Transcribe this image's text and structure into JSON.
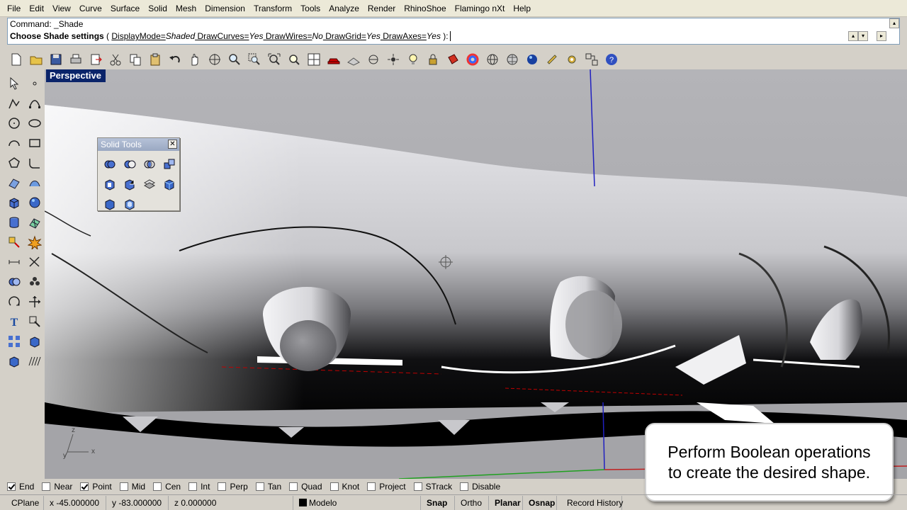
{
  "menu": [
    "File",
    "Edit",
    "View",
    "Curve",
    "Surface",
    "Solid",
    "Mesh",
    "Dimension",
    "Transform",
    "Tools",
    "Analyze",
    "Render",
    "RhinoShoe",
    "Flamingo nXt",
    "Help"
  ],
  "command": {
    "history_line": "Command: _Shade",
    "prompt_bold": "Choose Shade settings",
    "prompt_open": " ( ",
    "opt1_name": "DisplayMode=",
    "opt1_value": "Shaded",
    "opt2": " DrawCurves=",
    "opt2_value": "Yes",
    "opt3": " DrawWires=",
    "opt3_value": "No",
    "opt4": " DrawGrid=",
    "opt4_value": "Yes",
    "opt5": " DrawAxes=",
    "opt5_value": "Yes",
    "prompt_close": " ):"
  },
  "toolbar_icons": [
    "new-file-icon",
    "open-folder-icon",
    "save-icon",
    "print-icon",
    "export-icon",
    "cut-icon",
    "copy-icon",
    "paste-icon",
    "undo-icon",
    "pan-hand-icon",
    "rotate-view-icon",
    "zoom-icon",
    "zoom-window-icon",
    "zoom-extents-icon",
    "zoom-selected-icon",
    "four-viewports-icon",
    "car-icon",
    "grid-plane-icon",
    "cplane-icon",
    "point-icon",
    "light-bulb-icon",
    "lock-icon",
    "render-bucket-icon",
    "color-wheel-icon",
    "wire-sphere-icon",
    "mesh-sphere-icon",
    "shaded-sphere-icon",
    "render-light-icon",
    "gear-icon",
    "layout-icon",
    "help-icon"
  ],
  "viewport": {
    "title": "Perspective"
  },
  "axes": {
    "x": "x",
    "y": "y",
    "z": "z"
  },
  "solid_tools": {
    "title": "Solid Tools",
    "close": "✕"
  },
  "callout": {
    "line1": "Perform Boolean operations",
    "line2": "to create the desired shape."
  },
  "osnaps": [
    {
      "label": "End",
      "checked": true
    },
    {
      "label": "Near",
      "checked": false
    },
    {
      "label": "Point",
      "checked": true
    },
    {
      "label": "Mid",
      "checked": false
    },
    {
      "label": "Cen",
      "checked": false
    },
    {
      "label": "Int",
      "checked": false
    },
    {
      "label": "Perp",
      "checked": false
    },
    {
      "label": "Tan",
      "checked": false
    },
    {
      "label": "Quad",
      "checked": false
    },
    {
      "label": "Knot",
      "checked": false
    },
    {
      "label": "Project",
      "checked": false
    },
    {
      "label": "STrack",
      "checked": false
    },
    {
      "label": "Disable",
      "checked": false
    }
  ],
  "status": {
    "cplane": "CPlane",
    "x": "x -45.000000",
    "y": "y -83.000000",
    "z": "z 0.000000",
    "layer": "Modelo",
    "snap": "Snap",
    "ortho": "Ortho",
    "planar": "Planar",
    "osnap": "Osnap",
    "record": "Record History"
  }
}
